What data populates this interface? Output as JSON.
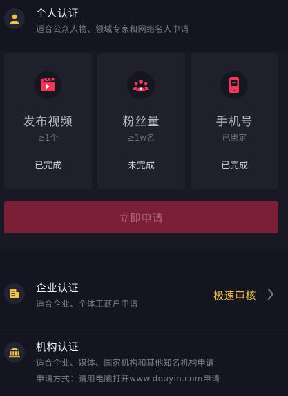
{
  "personal": {
    "title": "个人认证",
    "subtitle": "适合公众人物、领域专家和网络名人申请",
    "cards": [
      {
        "label": "发布视频",
        "requirement": "≥1个",
        "status": "已完成",
        "icon": "video-clapper-icon"
      },
      {
        "label": "粉丝量",
        "requirement": "≥1w名",
        "status": "未完成",
        "icon": "fans-group-icon"
      },
      {
        "label": "手机号",
        "requirement": "已绑定",
        "status": "已完成",
        "icon": "phone-icon"
      }
    ],
    "apply_button": "立即申请"
  },
  "enterprise": {
    "title": "企业认证",
    "subtitle": "适合企业、个体工商户申请",
    "badge": "极速审核"
  },
  "institution": {
    "title": "机构认证",
    "subtitle": "适合企业、媒体、国家机构和其他知名机构申请",
    "note": "申请方式：请用电脑打开www.douyin.com申请"
  },
  "colors": {
    "accent_yellow": "#f0c24a",
    "accent_red": "#f0365a",
    "button_bg": "#7a1f36"
  }
}
